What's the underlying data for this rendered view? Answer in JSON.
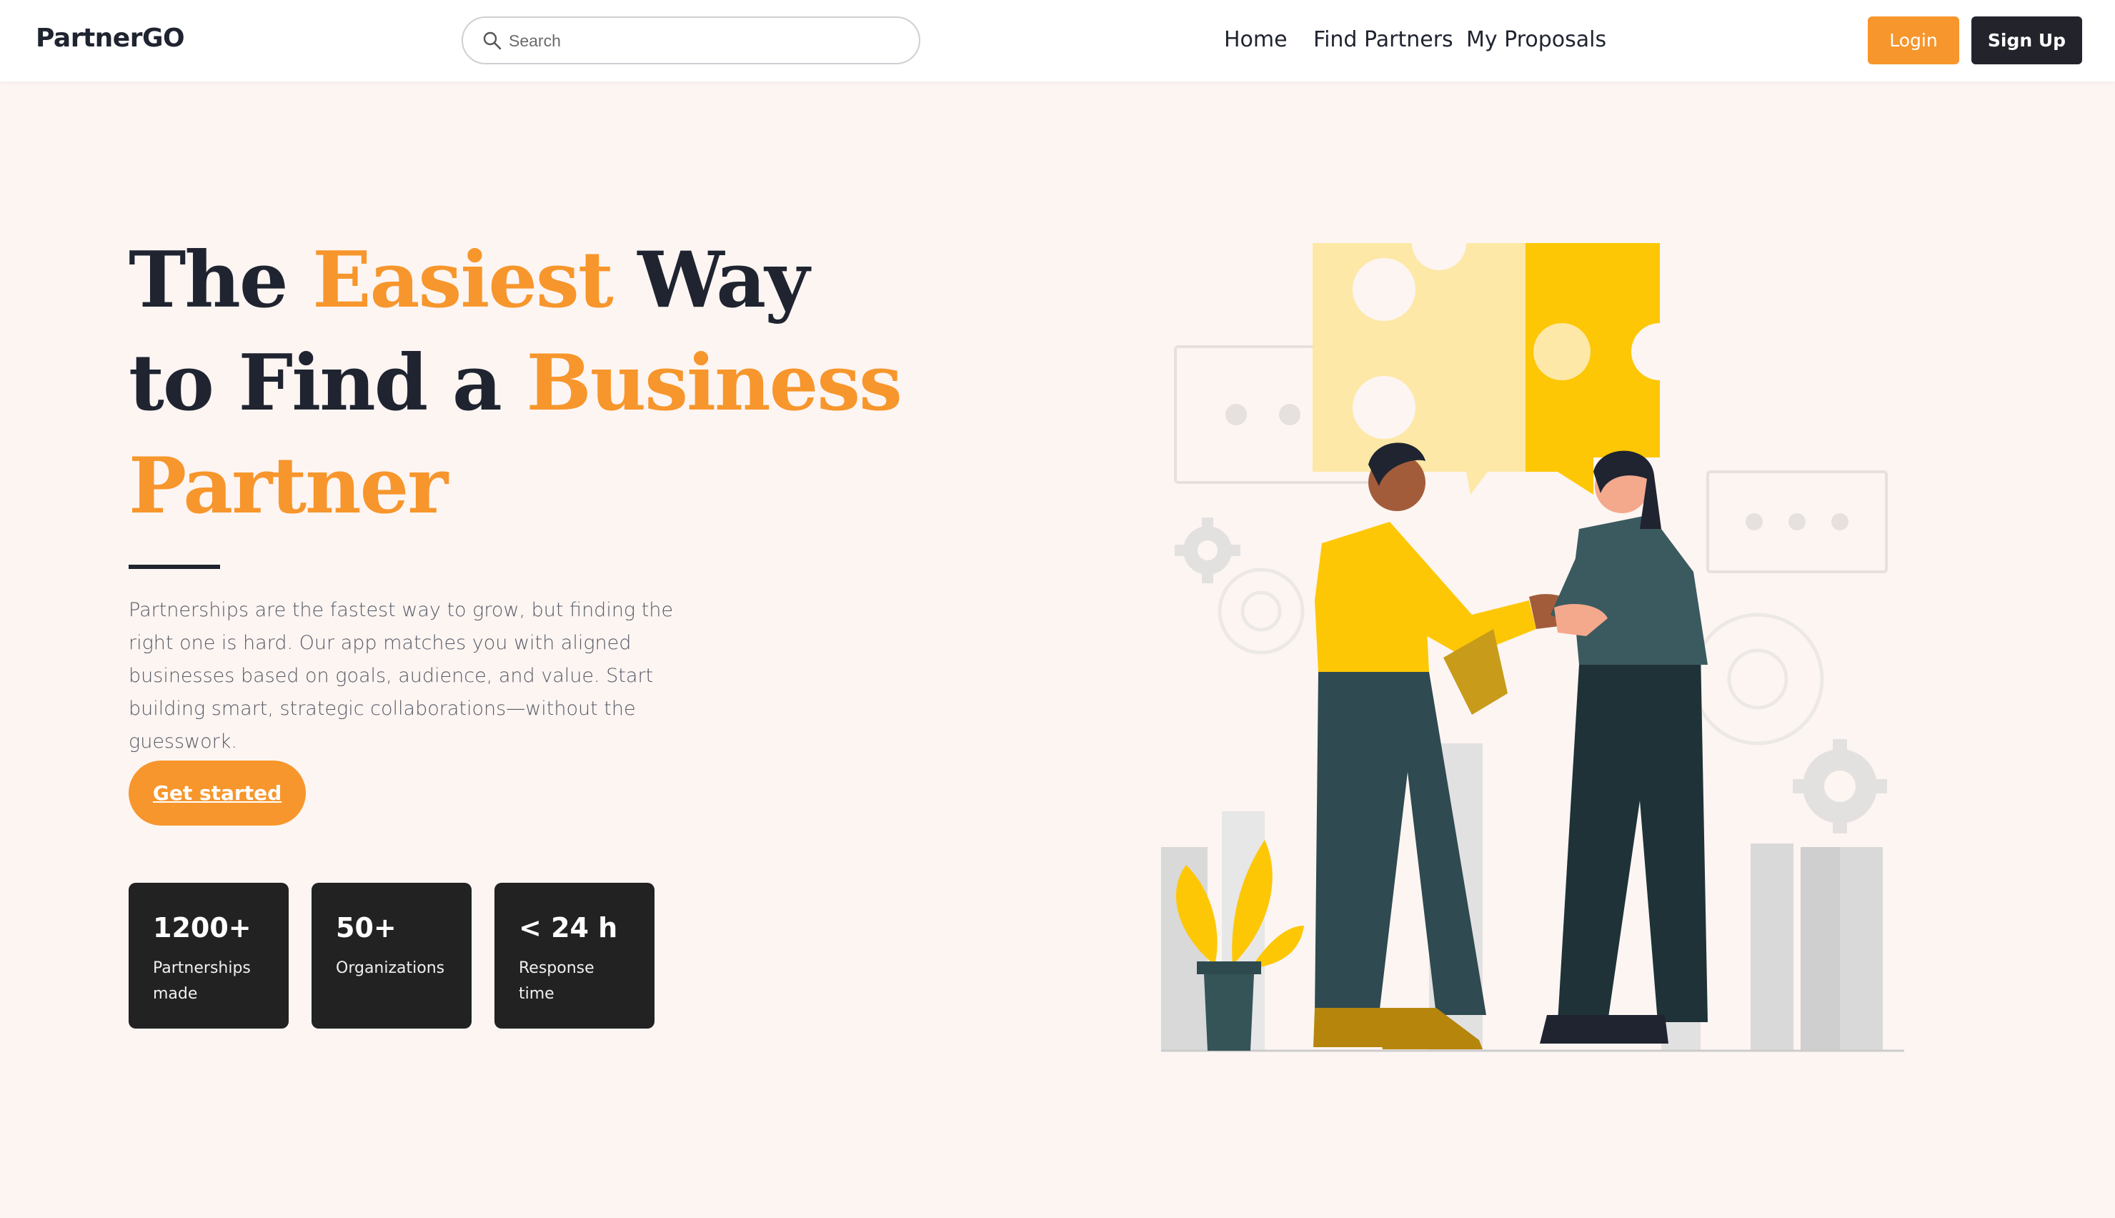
{
  "brand": "PartnerGO",
  "search": {
    "placeholder": "Search"
  },
  "nav": {
    "home": "Home",
    "find_partners": "Find Partners",
    "my_proposals": "My Proposals"
  },
  "auth": {
    "login": "Login",
    "signup": "Sign Up"
  },
  "hero": {
    "title": {
      "w1": "The",
      "w2": "Easiest",
      "w3": "Way",
      "w4": "to Find a",
      "w5": "Business",
      "w6": "Partner"
    },
    "description": "Partnerships are the fastest way to grow, but finding the right one is hard. Our app matches you with aligned businesses based on goals, audience, and value. Start building smart, strategic collaborations—without the guesswork.",
    "cta": "Get started"
  },
  "stats": [
    {
      "number": "1200+",
      "label": "Partnerships made"
    },
    {
      "number": "50+",
      "label": "Organizations"
    },
    {
      "number": "< 24 h",
      "label": "Response time"
    }
  ],
  "colors": {
    "accent": "#f7962c",
    "dark": "#1f2430",
    "background": "#fdf5f2",
    "card": "#222222"
  }
}
